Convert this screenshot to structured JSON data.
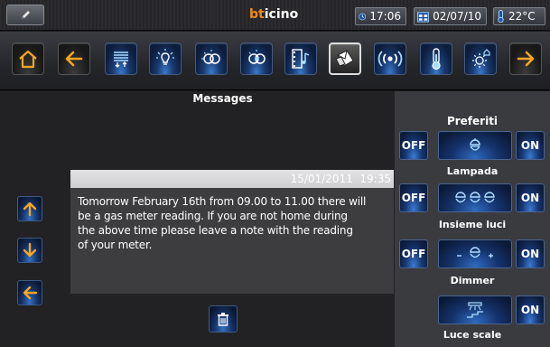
{
  "status": {
    "brand_prefix": "bt",
    "brand_suffix": "icino",
    "time": "17:06",
    "date": "02/07/10",
    "temperature": "22°C"
  },
  "toolbar": {
    "buttons": [
      {
        "icon": "home-icon"
      },
      {
        "icon": "arrow-left-icon"
      },
      {
        "icon": "shutters-icon"
      },
      {
        "icon": "light-bulb-icon"
      },
      {
        "icon": "scenario-icon"
      },
      {
        "icon": "scenario-2-icon"
      },
      {
        "icon": "multimedia-icon"
      },
      {
        "icon": "messages-icon"
      },
      {
        "icon": "wireless-icon"
      },
      {
        "icon": "thermometer-icon"
      },
      {
        "icon": "settings-icon"
      },
      {
        "icon": "arrow-right-icon"
      }
    ]
  },
  "messages": {
    "title": "Messages",
    "date": "15/01/2011",
    "time": "19:35",
    "lines": [
      "Tomorrow February 16th from 09.00 to 11.00 there will",
      "be a gas meter reading. If you are not home during",
      "the above time please leave a note with the reading",
      "of your meter."
    ]
  },
  "favourites": {
    "title": "Preferiti",
    "off_label": "OFF",
    "on_label": "ON",
    "items": [
      {
        "label": "Lampada",
        "icon": "lamp-icon"
      },
      {
        "label": "Insieme luci",
        "icon": "lights-group-icon"
      },
      {
        "label": "Dimmer",
        "icon": "dimmer-icon"
      },
      {
        "label": "Luce scale",
        "icon": "stairs-light-icon"
      }
    ]
  },
  "colors": {
    "accent_orange": "#f5a623",
    "brand_orange": "#f08a1c",
    "icon_blue": "#a8dcff"
  }
}
